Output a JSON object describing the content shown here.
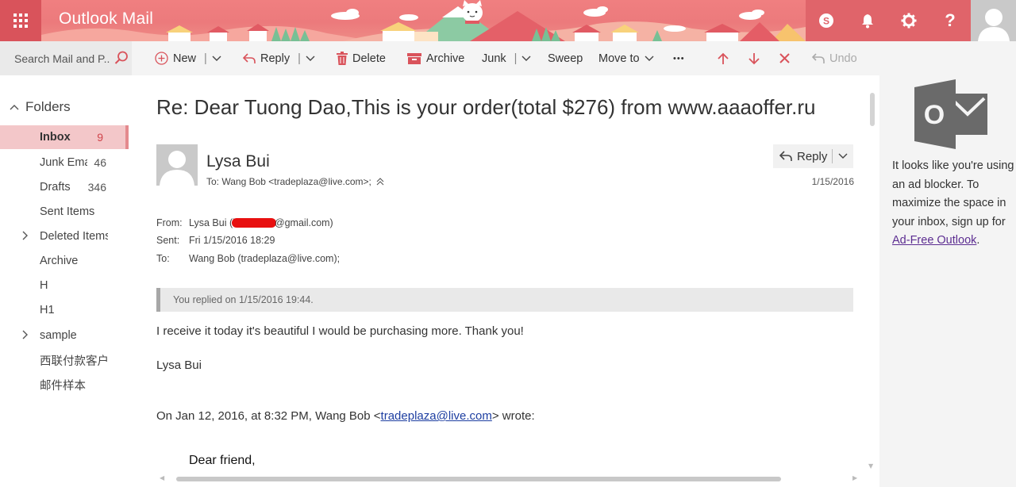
{
  "header": {
    "app_title": "Outlook Mail",
    "waffle_icon": "app-launcher-icon",
    "buttons": [
      "skype-icon",
      "bell-icon",
      "gear-icon",
      "help-icon"
    ],
    "help_label": "?",
    "accent": "#d9535b",
    "banner_color": "#f07f80"
  },
  "search": {
    "placeholder": "Search Mail and P..."
  },
  "toolbar": {
    "new_label": "New",
    "reply_label": "Reply",
    "delete_label": "Delete",
    "archive_label": "Archive",
    "junk_label": "Junk",
    "sweep_label": "Sweep",
    "move_to_label": "Move to",
    "more_label": "•••",
    "undo_label": "Undo",
    "sep": "|"
  },
  "folders": {
    "header": "Folders",
    "items": [
      {
        "label": "Inbox",
        "count": "9",
        "selected": true
      },
      {
        "label": "Junk Ema",
        "count": "46"
      },
      {
        "label": "Drafts",
        "count": "346"
      },
      {
        "label": "Sent Items",
        "count": ""
      },
      {
        "label": "Deleted Items",
        "count": "",
        "expandable": true
      },
      {
        "label": "Archive",
        "count": ""
      },
      {
        "label": "H",
        "count": ""
      },
      {
        "label": "H1",
        "count": ""
      },
      {
        "label": "sample",
        "count": "",
        "expandable": true
      },
      {
        "label": "西联付款客户",
        "count": ""
      },
      {
        "label": "邮件样本",
        "count": ""
      }
    ]
  },
  "message": {
    "subject": "Re: Dear Tuong Dao,This is your order(total $276) from www.aaaoffer.ru",
    "sender_name": "Lysa Bui",
    "to_line": "To: Wang Bob <tradeplaza@live.com>;",
    "reply_label": "Reply",
    "date": "1/15/2016",
    "from_key": "From:",
    "from_prefix": "Lysa Bui (l",
    "from_suffix": "@gmail.com)",
    "sent_key": "Sent:",
    "sent_value": "Fri 1/15/2016 18:29",
    "to_key": "To:",
    "to_value": "Wang Bob (tradeplaza@live.com);",
    "replied_notice": "You replied on 1/15/2016 19:44.",
    "body_line1": "I receive it today it's beautiful I would be purchasing more. Thank you!",
    "signature": "Lysa Bui",
    "quote_prefix": "On Jan 12, 2016, at 8:32 PM, Wang Bob <",
    "quote_link": "tradeplaza@live.com",
    "quote_suffix": "> wrote:",
    "quoted_greeting": "Dear friend,"
  },
  "ad": {
    "text": "It looks like you're using an ad blocker. To maximize the space in your inbox, sign up for ",
    "link": "Ad-Free Outlook",
    "period": ".",
    "logo_letter": "O"
  }
}
